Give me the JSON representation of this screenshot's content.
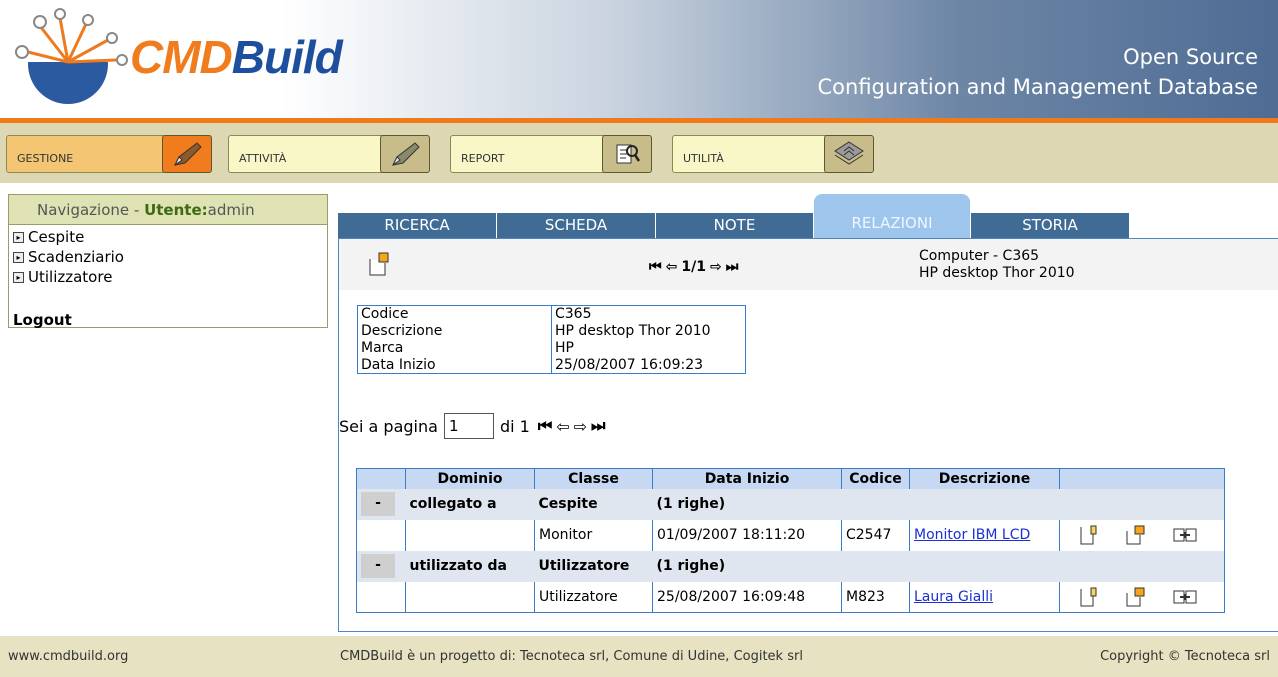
{
  "header": {
    "brand_cmd": "CMD",
    "brand_build": "Build",
    "tagline_line1": "Open Source",
    "tagline_line2": "Configuration and Management Database"
  },
  "menu": {
    "items": [
      {
        "label": "GESTIONE",
        "icon": "pen-icon"
      },
      {
        "label": "ATTIVITÀ",
        "icon": "pen-icon"
      },
      {
        "label": "REPORT",
        "icon": "report-magnifier-icon"
      },
      {
        "label": "UTILITÀ",
        "icon": "stack-icon"
      }
    ]
  },
  "navigation": {
    "title": "Navigazione - ",
    "user_label": "Utente:",
    "user_name": "admin",
    "items": [
      "Cespite",
      "Scadenziario",
      "Utilizzatore"
    ],
    "logout": "Logout"
  },
  "tabs": [
    "RICERCA",
    "SCHEDA",
    "NOTE",
    "RELAZIONI",
    "STORIA"
  ],
  "toolbar": {
    "pager": "1/1",
    "card_title_line1": "Computer - C365",
    "card_title_line2": "HP desktop Thor 2010"
  },
  "card": {
    "rows": [
      {
        "key": "Codice",
        "value": "C365"
      },
      {
        "key": "Descrizione",
        "value": "HP desktop Thor 2010"
      },
      {
        "key": "Marca",
        "value": "HP"
      },
      {
        "key": "Data Inizio",
        "value": "25/08/2007 16:09:23"
      }
    ]
  },
  "pager": {
    "prefix": "Sei a pagina",
    "value": "1",
    "suffix": "di 1"
  },
  "relations": {
    "headers": [
      "Dominio",
      "Classe",
      "Data Inizio",
      "Codice",
      "Descrizione"
    ],
    "groups": [
      {
        "toggle": "-",
        "domain": "collegato a",
        "class": "Cespite",
        "count": "(1 righe)",
        "row": {
          "class": "Monitor",
          "date": "01/09/2007 18:11:20",
          "code": "C2547",
          "description": "Monitor IBM LCD"
        }
      },
      {
        "toggle": "-",
        "domain": "utilizzato da",
        "class": "Utilizzatore",
        "count": "(1 righe)",
        "row": {
          "class": "Utilizzatore",
          "date": "25/08/2007 16:09:48",
          "code": "M823",
          "description": "Laura Gialli"
        }
      }
    ]
  },
  "footer": {
    "left": "www.cmdbuild.org",
    "center": "CMDBuild è un progetto di: Tecnoteca srl, Comune di Udine, Cogitek srl",
    "right": "Copyright © Tecnoteca srl"
  },
  "colors": {
    "accent_orange": "#f07c1e",
    "brand_blue": "#1d4f9e",
    "tab_blue": "#3f6b95",
    "tab_active": "#9ec6ec",
    "menu_bg": "#ddd7b4"
  }
}
